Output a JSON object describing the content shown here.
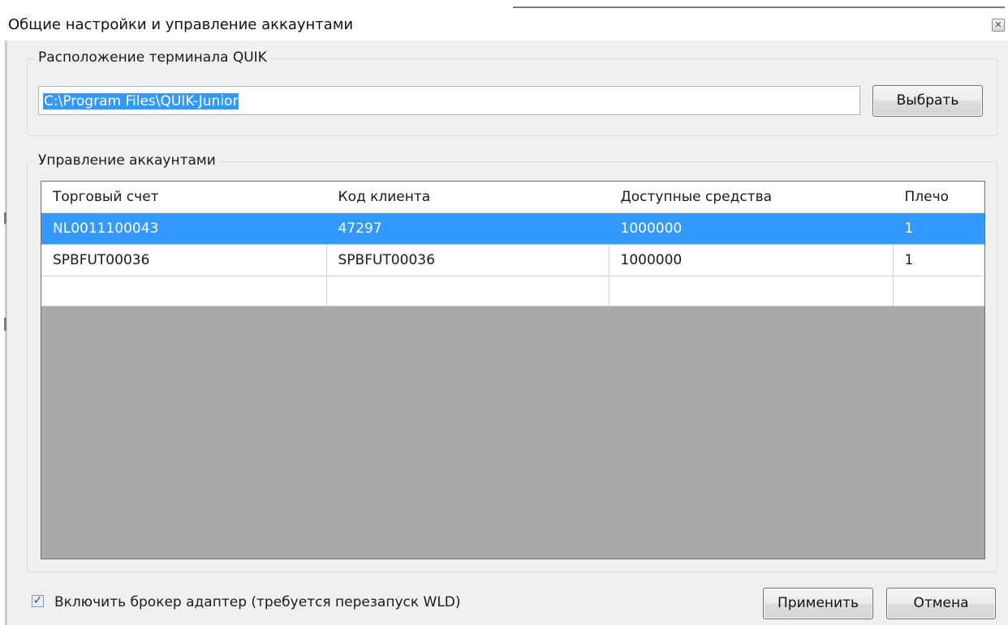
{
  "window": {
    "title": "Общие настройки и управление аккаунтами",
    "close_glyph": "✕"
  },
  "terminal": {
    "group_label": "Расположение терминала QUIK",
    "path_value": "C:\\Program Files\\QUIK-Junior",
    "browse_label": "Выбрать"
  },
  "accounts": {
    "group_label": "Управление аккаунтами",
    "columns": [
      "Торговый счет",
      "Код клиента",
      "Доступные средства",
      "Плечо"
    ],
    "rows": [
      {
        "account": "NL0011100043",
        "client_code": "47297",
        "funds": "1000000",
        "leverage": "1",
        "selected": true
      },
      {
        "account": "SPBFUT00036",
        "client_code": "SPBFUT00036",
        "funds": "1000000",
        "leverage": "1",
        "selected": false
      }
    ]
  },
  "footer": {
    "checkbox_label": "Включить брокер адаптер (требуется перезапуск WLD)",
    "checkbox_checked": true,
    "apply_label": "Применить",
    "cancel_label": "Отмена"
  },
  "colors": {
    "selection": "#3399ff",
    "grid_background": "#a9a9a9",
    "dialog_background": "#f0f0f0"
  },
  "icons": {
    "close": "close-icon",
    "checkmark": "checkmark-icon"
  }
}
